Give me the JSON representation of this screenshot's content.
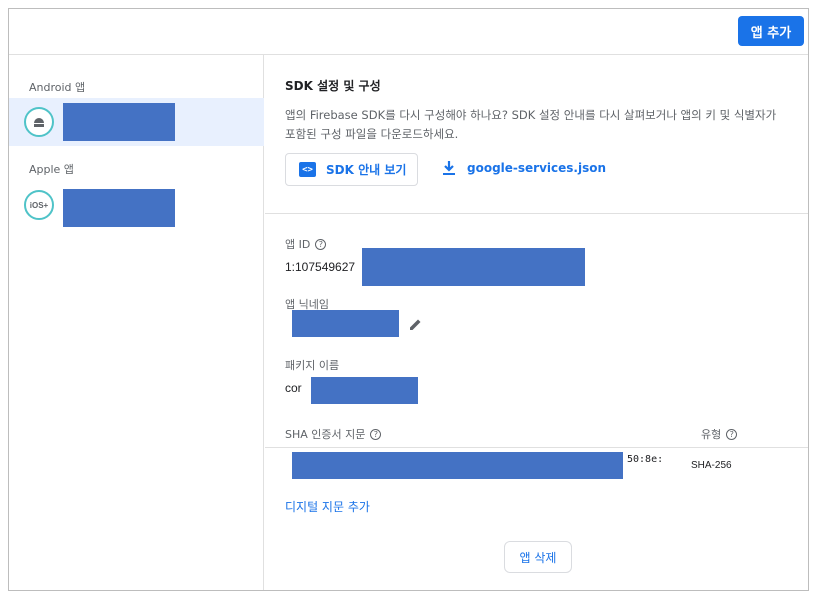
{
  "toolbar": {
    "add_app_label": "앱 추가"
  },
  "sidebar": {
    "android_section_label": "Android 앱",
    "apple_section_label": "Apple 앱",
    "ios_icon_text": "iOS+"
  },
  "sdk": {
    "title": "SDK 설정 및 구성",
    "description": "앱의 Firebase SDK를 다시 구성해야 하나요? SDK 설정 안내를 다시 살펴보거나 앱의 키 및 식별자가 포함된 구성 파일을 다운로드하세요.",
    "guide_button_label": "SDK 안내 보기",
    "guide_button_icon": "code-icon",
    "config_download_label": "google-services.json",
    "config_download_icon": "download-icon"
  },
  "details": {
    "app_id_label": "앱 ID",
    "app_id_value_visible": "1:107549627",
    "nickname_label": "앱 닉네임",
    "package_label": "패키지 이름",
    "package_value_visible": "cor",
    "sha_label": "SHA 인증서 지문",
    "type_label": "유형",
    "sha_value_visible": "50:8e:",
    "sha_type": "SHA-256",
    "add_fingerprint_label": "디지털 지문 추가",
    "delete_app_label": "앱 삭제"
  },
  "colors": {
    "accent": "#1a73e8",
    "redaction": "#4472c4",
    "selected_row": "#e8f0fe"
  }
}
